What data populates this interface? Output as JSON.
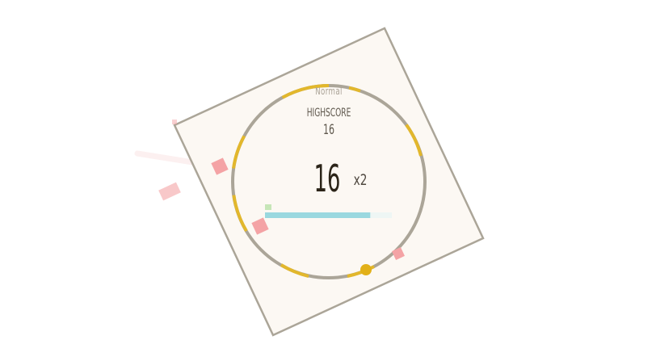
{
  "mode_label": "Normal",
  "highscore_label": "HIGHSCORE",
  "highscore_value": "16",
  "score": "16",
  "multiplier": "x2",
  "progress": 0.83,
  "colors": {
    "background": "#ffffff",
    "arena_fill": "#fcf8f3",
    "arena_border": "#aba598",
    "ring": "#aba598",
    "ring_accent": "#e2b72c",
    "player": "#e2b018",
    "enemy": "#f4a3a5",
    "progress_bar": "#9ad8df",
    "progress_marker": "#c6e6b7"
  },
  "icons": {
    "player": "player-dot",
    "enemies": "enemy-square"
  }
}
